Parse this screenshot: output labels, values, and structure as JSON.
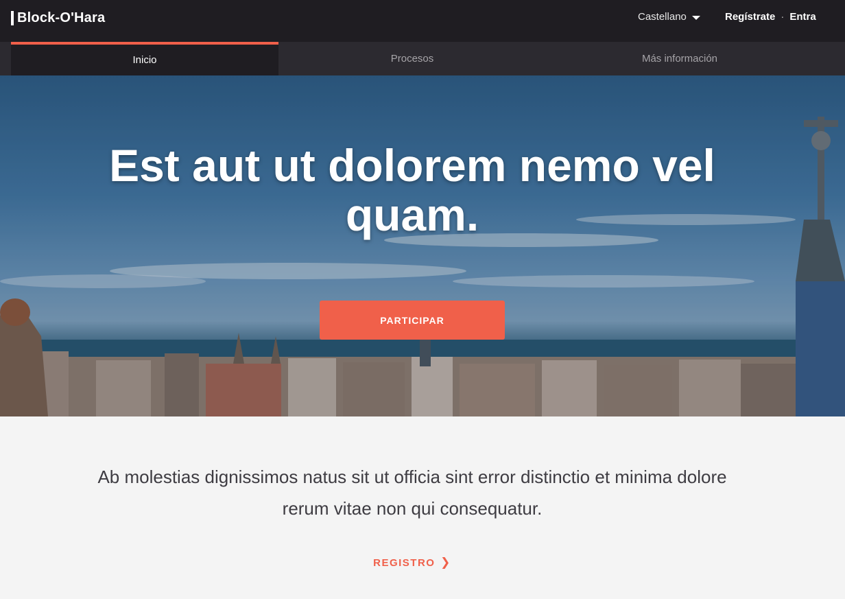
{
  "brand": {
    "name": "Block-O'Hara"
  },
  "header": {
    "language": "Castellano",
    "register": "Regístrate",
    "separator": "·",
    "login": "Entra"
  },
  "tabs": [
    {
      "label": "Inicio",
      "active": true
    },
    {
      "label": "Procesos",
      "active": false
    },
    {
      "label": "Más información",
      "active": false
    }
  ],
  "hero": {
    "title": "Est aut ut dolorem nemo vel quam.",
    "cta": "PARTICIPAR"
  },
  "intro": {
    "text": "Ab molestias dignissimos natus sit ut officia sint error distinctio et minima dolore rerum vitae non qui consequatur.",
    "link": "REGISTRO"
  },
  "icons": {
    "language_dropdown": "caret-down-icon",
    "register_link": "chevron-right-icon"
  },
  "colors": {
    "accent": "#f0604a",
    "topbar": "#1f1d22",
    "tabbar": "#2c2a30",
    "page": "#f4f4f4",
    "text": "#3e3c42"
  }
}
